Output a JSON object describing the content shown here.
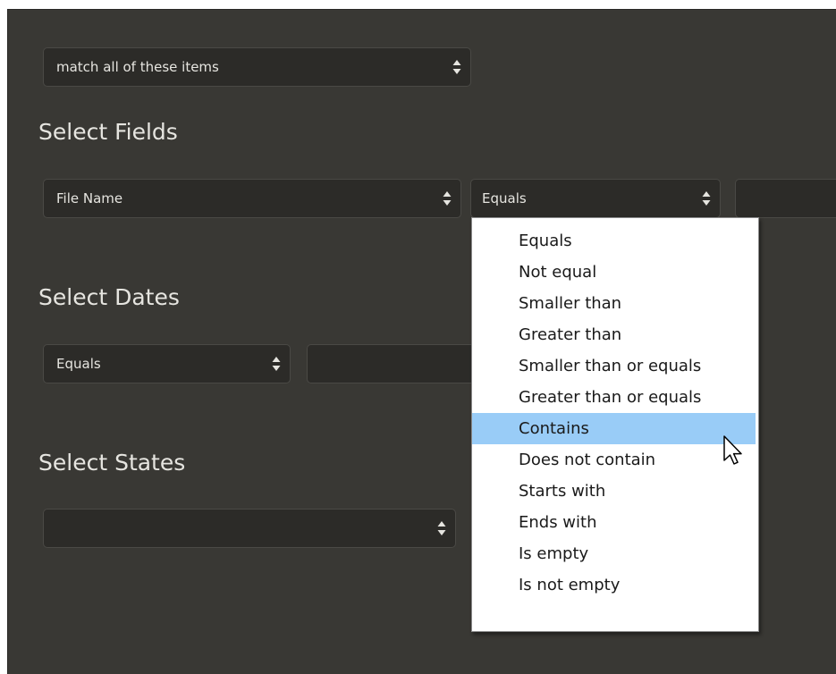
{
  "match_select": {
    "value": "match all of these items"
  },
  "fields": {
    "heading": "Select Fields",
    "field_select": {
      "value": "File Name"
    },
    "operator_select": {
      "value": "Equals"
    }
  },
  "dates": {
    "heading": "Select Dates",
    "operator_select": {
      "value": "Equals"
    }
  },
  "states": {
    "heading": "Select States",
    "state_select": {
      "value": ""
    }
  },
  "operator_options": [
    "Equals",
    "Not equal",
    "Smaller than",
    "Greater than",
    "Smaller than or equals",
    "Greater than or equals",
    "Contains",
    "Does not contain",
    "Starts with",
    "Ends with",
    "Is empty",
    "Is not empty"
  ],
  "highlighted_option_index": 6,
  "colors": {
    "panel_bg": "#393834",
    "control_bg": "#2c2b28",
    "highlight": "#99ccf7"
  },
  "icons": {
    "select_arrow": "updown-chevron-icon",
    "cursor": "mouse-pointer-icon"
  }
}
